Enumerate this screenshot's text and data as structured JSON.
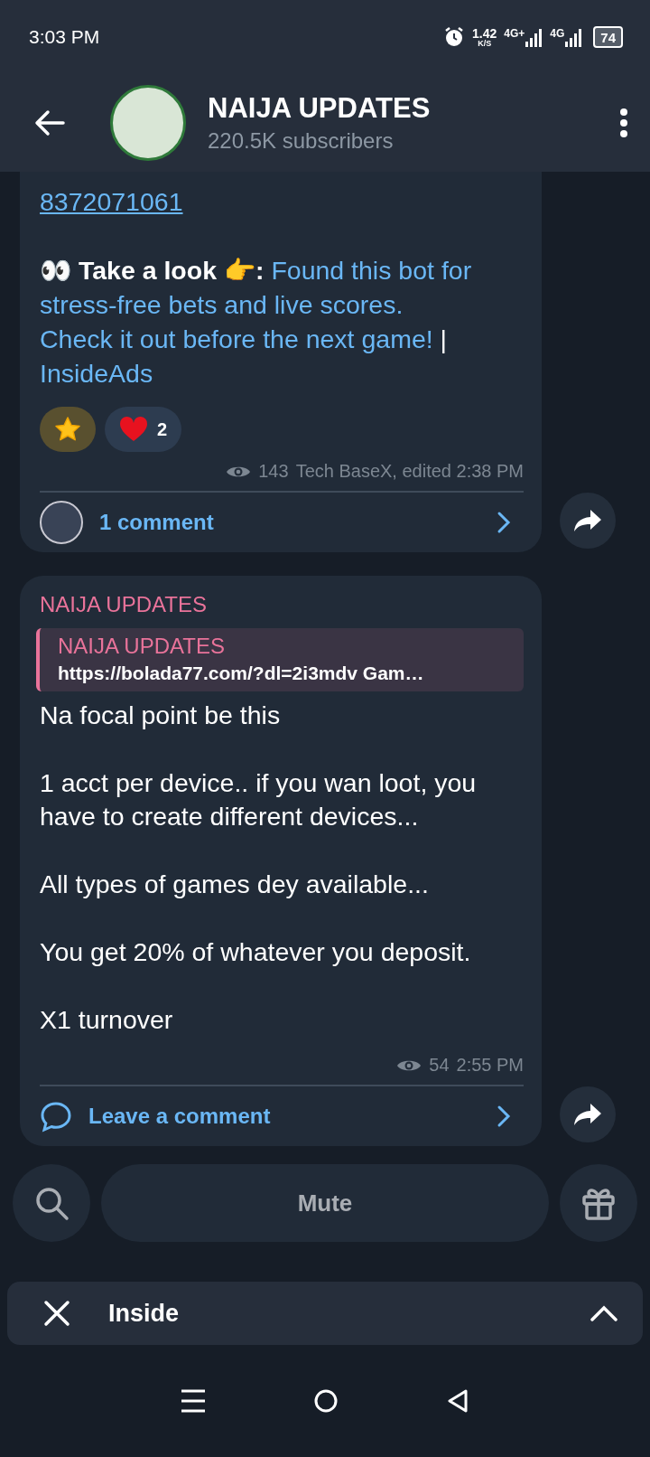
{
  "status_bar": {
    "time": "3:03 PM",
    "speed": "1.42",
    "speed_unit": "K/S",
    "network_1": "4G+",
    "network_2": "4G",
    "battery": "74"
  },
  "header": {
    "title": "NAIJA UPDATES",
    "subtitle": "220.5K subscribers"
  },
  "messages": [
    {
      "link_line": "8372071061",
      "paragraph": [
        {
          "kind": "bold",
          "text": "👀 Take a look 👉:"
        },
        {
          "kind": "link",
          "text": "Found this bot for"
        },
        {
          "kind": "link",
          "text": "stress-free bets and live scores."
        },
        {
          "kind": "link",
          "text": "Check it out before the next game!"
        },
        {
          "kind": "plain",
          "text": "|"
        },
        {
          "kind": "link",
          "text": "InsideAds"
        }
      ],
      "reactions": [
        {
          "kind": "star",
          "selected": true
        },
        {
          "kind": "heart",
          "count": "2",
          "selected": false
        }
      ],
      "views": "143",
      "meta": "Tech BaseX, edited 2:38 PM",
      "comments": {
        "kind": "avatar",
        "label": "1 comment"
      }
    },
    {
      "author": "NAIJA UPDATES",
      "quote": {
        "author": "NAIJA UPDATES",
        "text": "https://bolada77.com/?dl=2i3mdv  Gam…"
      },
      "lines": [
        "Na focal point be this",
        "1 acct per device.. if you wan loot, you have to create different devices...",
        "All types of games dey available...",
        "You get 20% of whatever you deposit.",
        "X1 turnover"
      ],
      "views": "54",
      "meta": "2:55 PM",
      "comments": {
        "kind": "bubble",
        "label": "Leave a comment"
      }
    }
  ],
  "bottom_bar": {
    "button": "Mute"
  },
  "ad_panel": {
    "title": "Inside"
  }
}
